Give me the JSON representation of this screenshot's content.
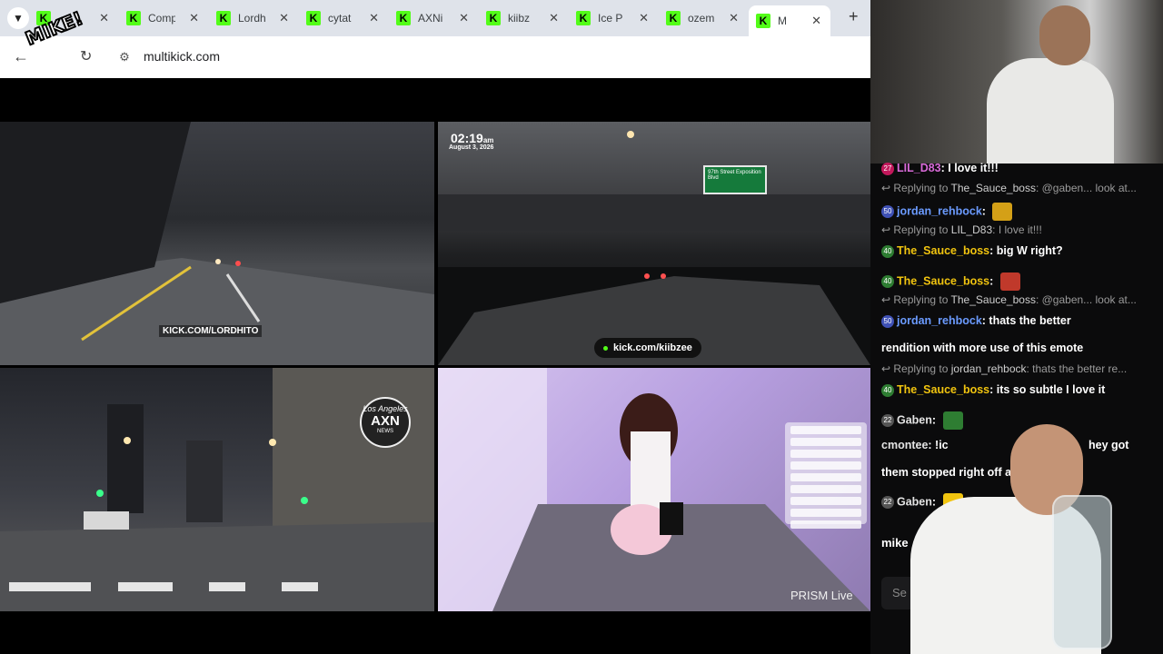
{
  "browser": {
    "tabs": [
      {
        "label": "",
        "active": false
      },
      {
        "label": "Comp",
        "active": false
      },
      {
        "label": "Lordh",
        "active": false
      },
      {
        "label": "cytat",
        "active": false
      },
      {
        "label": "AXNi",
        "active": false
      },
      {
        "label": "kiibz",
        "active": false
      },
      {
        "label": "Ice P",
        "active": false
      },
      {
        "label": "ozem",
        "active": false
      },
      {
        "label": "M",
        "active": true
      }
    ],
    "url": "multikick.com",
    "sticker": "MIKE!"
  },
  "streams": {
    "s1": {
      "tag": "KICK.COM/LORDHITO"
    },
    "s2": {
      "time": "02:19",
      "ampm": "am",
      "date": "August 3, 2026",
      "link": "kick.com/kiibzee",
      "sign": "97th Street Exposition Blvd"
    },
    "s3": {
      "logo_top": "Los Angeles",
      "logo_mid": "AXN",
      "logo_bottom": "NEWS"
    },
    "s4": {
      "watermark": "PRISM Live"
    }
  },
  "chat": {
    "messages": [
      {
        "kind": "msg",
        "badge": "27",
        "user": "LIL_D83",
        "user_color": "#d86ad8",
        "text": "I love it!!!"
      },
      {
        "kind": "reply",
        "to": "The_Sauce_boss",
        "text": "@gaben... look at..."
      },
      {
        "kind": "msg",
        "badge": "50",
        "user": "jordan_rehbock",
        "user_color": "#6b9bff",
        "text": ""
      },
      {
        "kind": "reply",
        "to": "LIL_D83",
        "text": "I love it!!!"
      },
      {
        "kind": "msg",
        "badge": "40",
        "user": "The_Sauce_boss",
        "user_color": "#f1c40f",
        "text": "big W right?"
      },
      {
        "kind": "msg",
        "badge": "40",
        "user": "The_Sauce_boss",
        "user_color": "#f1c40f",
        "text": ""
      },
      {
        "kind": "reply",
        "to": "The_Sauce_boss",
        "text": "@gaben... look at..."
      },
      {
        "kind": "msg",
        "badge": "50",
        "user": "jordan_rehbock",
        "user_color": "#6b9bff",
        "text": "thats the better"
      },
      {
        "kind": "cont",
        "text": "rendition with more use of this emote"
      },
      {
        "kind": "reply",
        "to": "jordan_rehbock",
        "text": "thats the better re..."
      },
      {
        "kind": "msg",
        "badge": "40",
        "user": "The_Sauce_boss",
        "user_color": "#f1c40f",
        "text": "its so subtle I love it"
      },
      {
        "kind": "msg",
        "badge": "22",
        "user": "Gaben",
        "user_color": "#e4e4e4",
        "text": ""
      },
      {
        "kind": "msg",
        "badge": "",
        "user": "cmontee",
        "user_color": "#e4e4e4",
        "text": "!ic"
      },
      {
        "kind": "cont",
        "text": "them stopped right off a"
      },
      {
        "kind": "msg",
        "badge": "22",
        "user": "Gaben",
        "user_color": "#e4e4e4",
        "text": ""
      }
    ],
    "cont_tail": "hey got",
    "self_user": "mike",
    "input_placeholder": "Se"
  },
  "colors": {
    "kick_green": "#53fc18",
    "chat_bg": "#0b0b0c"
  }
}
